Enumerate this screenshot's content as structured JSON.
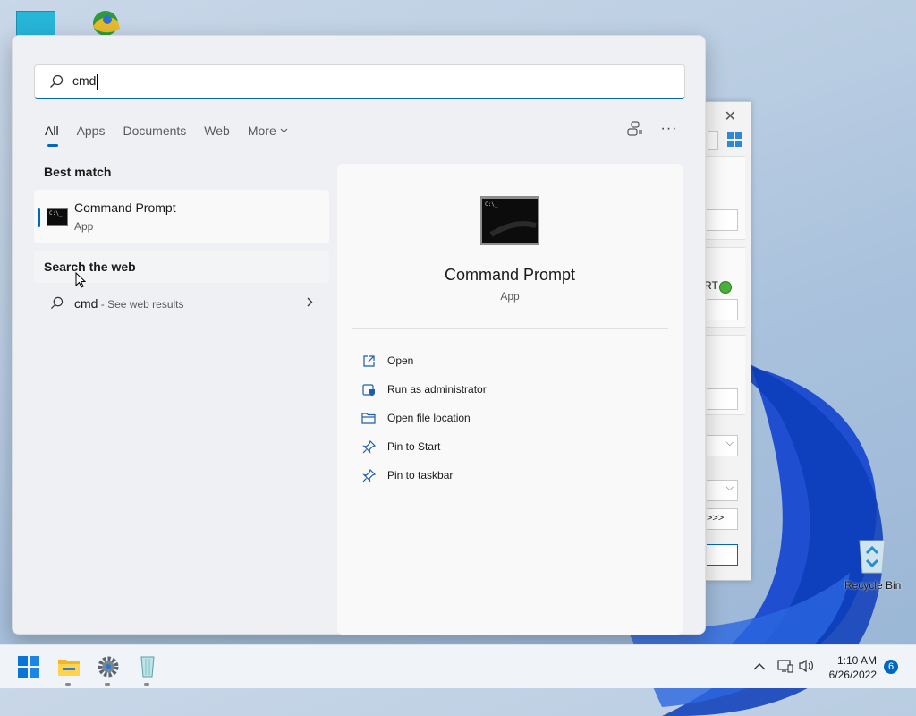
{
  "search": {
    "query": "cmd"
  },
  "tabs": [
    {
      "label": "All",
      "active": true
    },
    {
      "label": "Apps"
    },
    {
      "label": "Documents"
    },
    {
      "label": "Web"
    },
    {
      "label": "More"
    }
  ],
  "best_match": {
    "heading": "Best match",
    "name": "Command Prompt",
    "type": "App"
  },
  "web": {
    "heading": "Search the web",
    "query": "cmd",
    "suffix": " - See web results"
  },
  "detail": {
    "title": "Command Prompt",
    "type": "App",
    "actions": [
      {
        "label": "Open",
        "icon": "open-external-icon"
      },
      {
        "label": "Run as administrator",
        "icon": "shield-admin-icon"
      },
      {
        "label": "Open file location",
        "icon": "folder-icon"
      },
      {
        "label": "Pin to Start",
        "icon": "pin-icon"
      },
      {
        "label": "Pin to taskbar",
        "icon": "pin-icon"
      }
    ]
  },
  "desktop": {
    "recycle_bin_label": "Recycle Bin",
    "bg_window_text": "RT"
  },
  "taskbar": {
    "time": "1:10 AM",
    "date": "6/26/2022",
    "notification_count": "6"
  },
  "colors": {
    "accent": "#0067c0"
  }
}
